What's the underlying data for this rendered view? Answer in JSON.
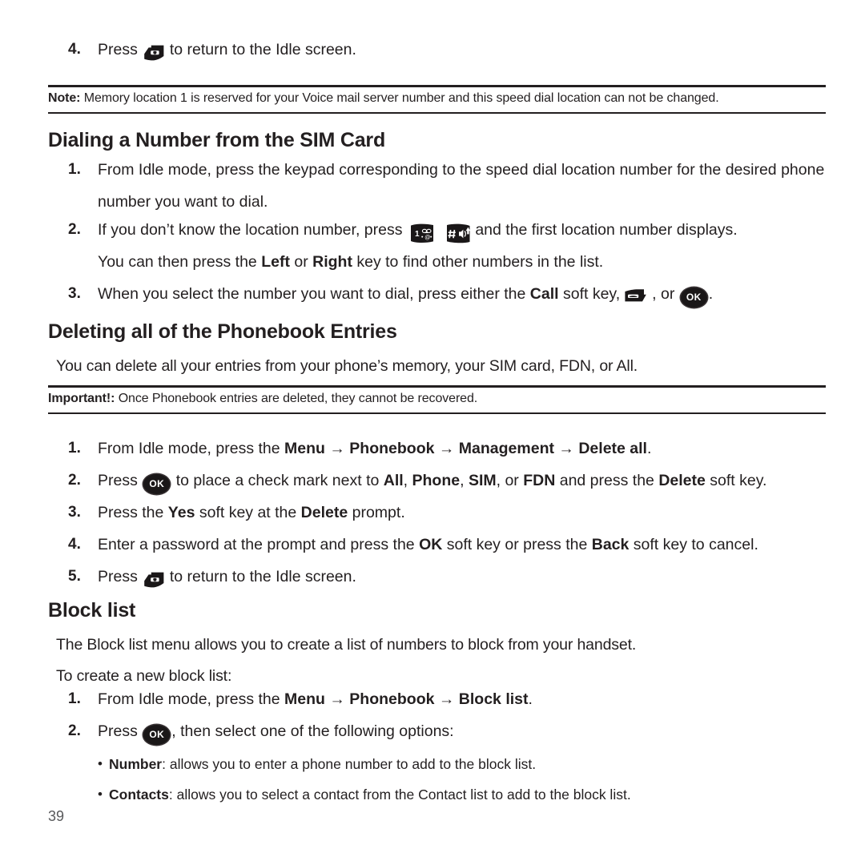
{
  "page": {
    "number": "39"
  },
  "steps_top": {
    "item4": {
      "num": "4.",
      "pre": "Press",
      "icon": "end-key-icon",
      "post": "to return to the Idle screen."
    }
  },
  "note_box": {
    "label": "Note:",
    "text": "Memory location 1 is reserved for your Voice mail server number and this speed dial location can not be changed."
  },
  "section_sim": {
    "heading": "Dialing a Number from the SIM Card",
    "steps": [
      {
        "num": "1.",
        "line1": "From Idle mode, press the keypad corresponding to the speed dial location number for the desired phone",
        "line2": "number you want to dial."
      },
      {
        "num": "2.",
        "pre": "If you don’t know the location number, press",
        "icon1": "keypad-1-key-icon",
        "icon2": "keypad-hash-key-icon",
        "post": "and the first location number displays.",
        "line2_pre": "You can then press the",
        "line2_b1": "Left",
        "line2_mid": "or",
        "line2_b2": "Right",
        "line2_post": "key to find other numbers in the list."
      },
      {
        "num": "3.",
        "pre": "When you select the number you want to dial, press either the",
        "bold": "Call",
        "mid": "soft key,",
        "icon1": "send-key-icon",
        "sep": ", or",
        "icon2": "ok-key-icon",
        "post": "."
      }
    ]
  },
  "section_delete": {
    "heading": "Deleting all of the Phonebook Entries",
    "intro": "You can delete all your entries from your phone’s memory, your SIM card, FDN, or All.",
    "important": {
      "label": "Important!:",
      "text": "Once Phonebook entries are deleted, they cannot be recovered."
    },
    "steps": [
      {
        "num": "1.",
        "pre": "From Idle mode, press the",
        "path": [
          "Menu",
          "Phonebook",
          "Management",
          "Delete all"
        ],
        "arrow": "→",
        "post": "."
      },
      {
        "num": "2.",
        "pre": "Press",
        "icon": "ok-key-icon",
        "mid": "to place a check mark next to",
        "opts": [
          "All",
          "Phone",
          "SIM",
          "FDN"
        ],
        "mid2": "and press the",
        "bold2": "Delete",
        "post": "soft key."
      },
      {
        "num": "3.",
        "pre": "Press the",
        "bold1": "Yes",
        "mid": "soft key at the",
        "bold2": "Delete",
        "post": "prompt."
      },
      {
        "num": "4.",
        "pre": "Enter a password at the prompt and press the",
        "bold1": "OK",
        "mid": "soft key or press the",
        "bold2": "Back",
        "post": "soft key to cancel."
      },
      {
        "num": "5.",
        "pre": "Press",
        "icon": "end-key-icon",
        "post": "to return to the Idle screen."
      }
    ]
  },
  "section_block": {
    "heading": "Block list",
    "intro1": "The Block list menu allows you to create a list of numbers to block from your handset.",
    "intro2": "To create a new block list:",
    "steps": [
      {
        "num": "1.",
        "pre": "From Idle mode, press the",
        "path": [
          "Menu",
          "Phonebook",
          "Block list"
        ],
        "arrow": "→",
        "post": "."
      },
      {
        "num": "2.",
        "pre": "Press",
        "icon": "ok-key-icon",
        "post": ", then select one of the following options:"
      }
    ],
    "bullets": [
      {
        "dot": "•",
        "term": "Number",
        "desc": ": allows you to enter a phone number to add to the block list."
      },
      {
        "dot": "•",
        "term": "Contacts",
        "desc": ": allows you to select a contact from the Contact list to add to the block list."
      }
    ]
  },
  "colors": {
    "text": "#231f20",
    "rule": "#231f20",
    "page_number": "#58595b"
  }
}
